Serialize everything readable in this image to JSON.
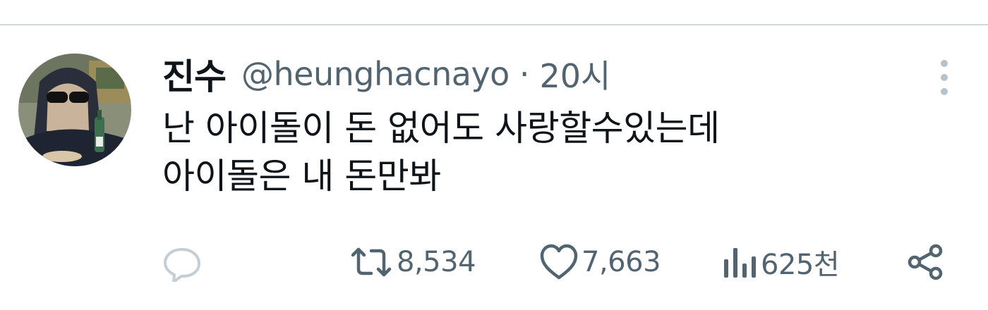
{
  "tweet": {
    "display_name": "진수",
    "handle": "@heunghacnayo",
    "separator": "·",
    "time": "20시",
    "text_lines": [
      "난 아이돌이 돈 없어도 사랑할수있는데",
      "아이돌은 내 돈만봐"
    ]
  },
  "actions": {
    "reply": {
      "icon": "reply-icon",
      "count": ""
    },
    "retweet": {
      "icon": "retweet-icon",
      "count": "8,534"
    },
    "like": {
      "icon": "heart-icon",
      "count": "7,663"
    },
    "views": {
      "icon": "views-icon",
      "count": "625천"
    },
    "share": {
      "icon": "share-icon"
    }
  },
  "header": {
    "more_icon": "more-vertical-icon"
  },
  "colors": {
    "text": "#0f1419",
    "secondary": "#536471",
    "divider": "#cfd9de"
  }
}
